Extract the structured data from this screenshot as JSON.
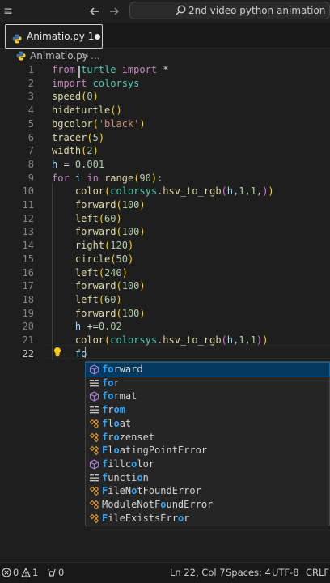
{
  "titlebar": {
    "back_icon": "arrow-left-icon",
    "forward_icon": "arrow-right-icon",
    "search_text": "2nd video python animation"
  },
  "tab": {
    "label": "Animatio.py",
    "badge": "1"
  },
  "breadcrumb": {
    "file": "Animatio.py",
    "separator": ">",
    "more": "..."
  },
  "editor": {
    "line_numbers": [
      "1",
      "2",
      "3",
      "4",
      "5",
      "6",
      "7",
      "8",
      "9",
      "10",
      "11",
      "12",
      "13",
      "14",
      "15",
      "16",
      "17",
      "18",
      "19",
      "20",
      "21",
      "22"
    ],
    "lines": [
      [
        {
          "t": "from",
          "c": "kw"
        },
        {
          "t": " turtle ",
          "c": "mod"
        },
        {
          "t": "import",
          "c": "kw"
        },
        {
          "t": " *",
          "c": ""
        }
      ],
      [
        {
          "t": "import",
          "c": "kw"
        },
        {
          "t": " colorsys",
          "c": "mod"
        }
      ],
      [
        {
          "t": "speed",
          "c": "fn"
        },
        {
          "t": "(",
          "c": "br"
        },
        {
          "t": "0",
          "c": "num"
        },
        {
          "t": ")",
          "c": "br"
        }
      ],
      [
        {
          "t": "hideturtle",
          "c": "fn"
        },
        {
          "t": "()",
          "c": "br"
        }
      ],
      [
        {
          "t": "bgcolor",
          "c": "fn"
        },
        {
          "t": "(",
          "c": "br"
        },
        {
          "t": "'black'",
          "c": "str"
        },
        {
          "t": ")",
          "c": "br"
        }
      ],
      [
        {
          "t": "tracer",
          "c": "fn"
        },
        {
          "t": "(",
          "c": "br"
        },
        {
          "t": "5",
          "c": "num"
        },
        {
          "t": ")",
          "c": "br"
        }
      ],
      [
        {
          "t": "width",
          "c": "fn"
        },
        {
          "t": "(",
          "c": "br"
        },
        {
          "t": "2",
          "c": "num"
        },
        {
          "t": ")",
          "c": "br"
        }
      ],
      [
        {
          "t": "h",
          "c": "var"
        },
        {
          "t": " = ",
          "c": ""
        },
        {
          "t": "0.001",
          "c": "num"
        }
      ],
      [
        {
          "t": "for",
          "c": "kw"
        },
        {
          "t": " i ",
          "c": "var"
        },
        {
          "t": "in",
          "c": "kw"
        },
        {
          "t": " ",
          "c": ""
        },
        {
          "t": "range",
          "c": "fn"
        },
        {
          "t": "(",
          "c": "br"
        },
        {
          "t": "90",
          "c": "num"
        },
        {
          "t": ")",
          "c": "br"
        },
        {
          "t": ":",
          "c": ""
        }
      ],
      [
        {
          "t": "    ",
          "c": ""
        },
        {
          "t": "color",
          "c": "fn"
        },
        {
          "t": "(",
          "c": "br"
        },
        {
          "t": "colorsys",
          "c": "mod"
        },
        {
          "t": ".",
          "c": ""
        },
        {
          "t": "hsv_to_rgb",
          "c": "fn"
        },
        {
          "t": "(",
          "c": "br2"
        },
        {
          "t": "h",
          "c": "var"
        },
        {
          "t": ",",
          "c": ""
        },
        {
          "t": "1",
          "c": "num"
        },
        {
          "t": ",",
          "c": ""
        },
        {
          "t": "1",
          "c": "num"
        },
        {
          "t": ",",
          "c": ""
        },
        {
          "t": ")",
          "c": "br2"
        },
        {
          "t": ")",
          "c": "br"
        }
      ],
      [
        {
          "t": "    ",
          "c": ""
        },
        {
          "t": "forward",
          "c": "fn"
        },
        {
          "t": "(",
          "c": "br"
        },
        {
          "t": "100",
          "c": "num"
        },
        {
          "t": ")",
          "c": "br"
        }
      ],
      [
        {
          "t": "    ",
          "c": ""
        },
        {
          "t": "left",
          "c": "fn"
        },
        {
          "t": "(",
          "c": "br"
        },
        {
          "t": "60",
          "c": "num"
        },
        {
          "t": ")",
          "c": "br"
        }
      ],
      [
        {
          "t": "    ",
          "c": ""
        },
        {
          "t": "forward",
          "c": "fn"
        },
        {
          "t": "(",
          "c": "br"
        },
        {
          "t": "100",
          "c": "num"
        },
        {
          "t": ")",
          "c": "br"
        }
      ],
      [
        {
          "t": "    ",
          "c": ""
        },
        {
          "t": "right",
          "c": "fn"
        },
        {
          "t": "(",
          "c": "br"
        },
        {
          "t": "120",
          "c": "num"
        },
        {
          "t": ")",
          "c": "br"
        }
      ],
      [
        {
          "t": "    ",
          "c": ""
        },
        {
          "t": "circle",
          "c": "fn"
        },
        {
          "t": "(",
          "c": "br"
        },
        {
          "t": "50",
          "c": "num"
        },
        {
          "t": ")",
          "c": "br"
        }
      ],
      [
        {
          "t": "    ",
          "c": ""
        },
        {
          "t": "left",
          "c": "fn"
        },
        {
          "t": "(",
          "c": "br"
        },
        {
          "t": "240",
          "c": "num"
        },
        {
          "t": ")",
          "c": "br"
        }
      ],
      [
        {
          "t": "    ",
          "c": ""
        },
        {
          "t": "forward",
          "c": "fn"
        },
        {
          "t": "(",
          "c": "br"
        },
        {
          "t": "100",
          "c": "num"
        },
        {
          "t": ")",
          "c": "br"
        }
      ],
      [
        {
          "t": "    ",
          "c": ""
        },
        {
          "t": "left",
          "c": "fn"
        },
        {
          "t": "(",
          "c": "br"
        },
        {
          "t": "60",
          "c": "num"
        },
        {
          "t": ")",
          "c": "br"
        }
      ],
      [
        {
          "t": "    ",
          "c": ""
        },
        {
          "t": "forward",
          "c": "fn"
        },
        {
          "t": "(",
          "c": "br"
        },
        {
          "t": "100",
          "c": "num"
        },
        {
          "t": ")",
          "c": "br"
        }
      ],
      [
        {
          "t": "    ",
          "c": ""
        },
        {
          "t": "h",
          "c": "var"
        },
        {
          "t": " +=",
          "c": ""
        },
        {
          "t": "0.02",
          "c": "num"
        }
      ],
      [
        {
          "t": "    ",
          "c": ""
        },
        {
          "t": "color",
          "c": "fn"
        },
        {
          "t": "(",
          "c": "br"
        },
        {
          "t": "colorsys",
          "c": "mod"
        },
        {
          "t": ".",
          "c": ""
        },
        {
          "t": "hsv_to_rgb",
          "c": "fn"
        },
        {
          "t": "(",
          "c": "br2"
        },
        {
          "t": "h",
          "c": "var"
        },
        {
          "t": ",",
          "c": ""
        },
        {
          "t": "1",
          "c": "num"
        },
        {
          "t": ",",
          "c": ""
        },
        {
          "t": "1",
          "c": "num"
        },
        {
          "t": ")",
          "c": "br2"
        },
        {
          "t": ")",
          "c": "br"
        }
      ],
      [
        {
          "t": "    ",
          "c": ""
        },
        {
          "t": "fo",
          "c": "var"
        }
      ]
    ]
  },
  "suggestions": [
    {
      "match": "fo",
      "rest": "rward",
      "icon": "method-cube-icon",
      "selected": true
    },
    {
      "match": "fo",
      "rest": "r",
      "icon": "keyword-icon",
      "selected": false
    },
    {
      "match": "fo",
      "rest": "rmat",
      "icon": "method-cube-icon",
      "selected": false
    },
    {
      "match": "f",
      "rest": "r",
      "tail": "om",
      "icon": "keyword-icon",
      "selected": false
    },
    {
      "match": "f",
      "rest": "l",
      "tail": "o",
      "tail2": "at",
      "icon": "class-icon",
      "selected": false
    },
    {
      "match": "f",
      "rest": "r",
      "tail": "o",
      "tail2": "zenset",
      "icon": "class-icon",
      "selected": false
    },
    {
      "match": "F",
      "rest": "l",
      "tail": "o",
      "tail2": "atingPointError",
      "icon": "class-icon",
      "selected": false
    },
    {
      "match": "f",
      "rest": "illc",
      "tail": "o",
      "tail2": "lor",
      "icon": "method-cube-icon",
      "selected": false
    },
    {
      "match": "f",
      "rest": "uncti",
      "tail": "o",
      "tail2": "n",
      "icon": "keyword-icon",
      "selected": false
    },
    {
      "match": "F",
      "rest": "ileN",
      "tail": "o",
      "tail2": "tFoundError",
      "icon": "class-icon",
      "selected": false
    },
    {
      "match": "",
      "rest": "ModuleNotF",
      "tail": "o",
      "tail2": "undError",
      "icon": "class-icon",
      "selected": false
    },
    {
      "match": "F",
      "rest": "ileExistsErr",
      "tail": "o",
      "tail2": "r",
      "icon": "class-icon",
      "selected": false
    }
  ],
  "statusbar": {
    "errors": "0",
    "warnings": "1",
    "ports": "0",
    "position": "Ln 22, Col 7",
    "spaces": "Spaces: 4",
    "encoding": "UTF-8",
    "eol": "CRLF"
  },
  "colors": {
    "accent": "#2aaaff",
    "selection": "#04395e",
    "background": "#1e1e1e"
  }
}
